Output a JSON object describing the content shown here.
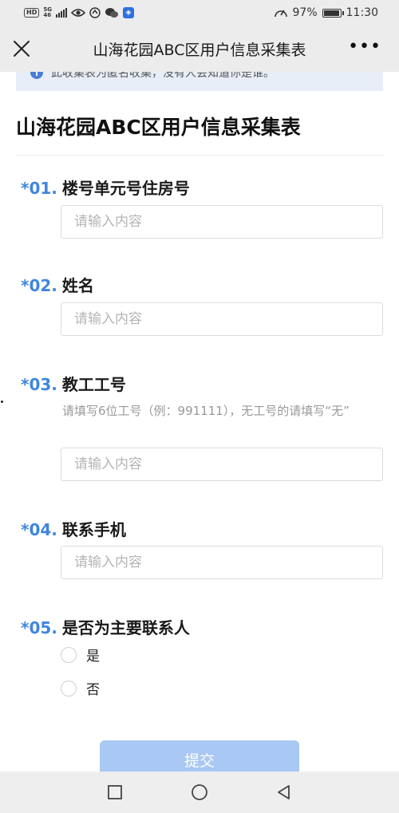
{
  "status_bar": {
    "hd": "HD",
    "net_top": "5G",
    "net_bottom": "46",
    "battery_percent": 97,
    "battery_text": "97%",
    "time": "11:30",
    "colors": {
      "bar_bg": "#ececec"
    }
  },
  "nav": {
    "title": "山海花园ABC区用户信息采集表",
    "more_label": "•••"
  },
  "notice": {
    "text": "此收集表为匿名收集，没有人会知道你是谁。",
    "icon": "info-icon"
  },
  "form": {
    "title": "山海花园ABC区用户信息采集表",
    "questions": [
      {
        "num": "*01.",
        "label": "楼号单元号住房号",
        "placeholder": "请输入内容"
      },
      {
        "num": "*02.",
        "label": "姓名",
        "placeholder": "请输入内容"
      },
      {
        "num": "*03.",
        "label": "教工工号",
        "hint": "请填写6位工号（例：991111），无工号的请填写“无”",
        "placeholder": "请输入内容"
      },
      {
        "num": "*04.",
        "label": "联系手机",
        "placeholder": "请输入内容"
      },
      {
        "num": "*05.",
        "label": "是否为主要联系人",
        "options": [
          "是",
          "否"
        ]
      }
    ],
    "submit_label": "提交",
    "accent_color": "#3f86db",
    "submit_color": "#a9c8f3"
  }
}
